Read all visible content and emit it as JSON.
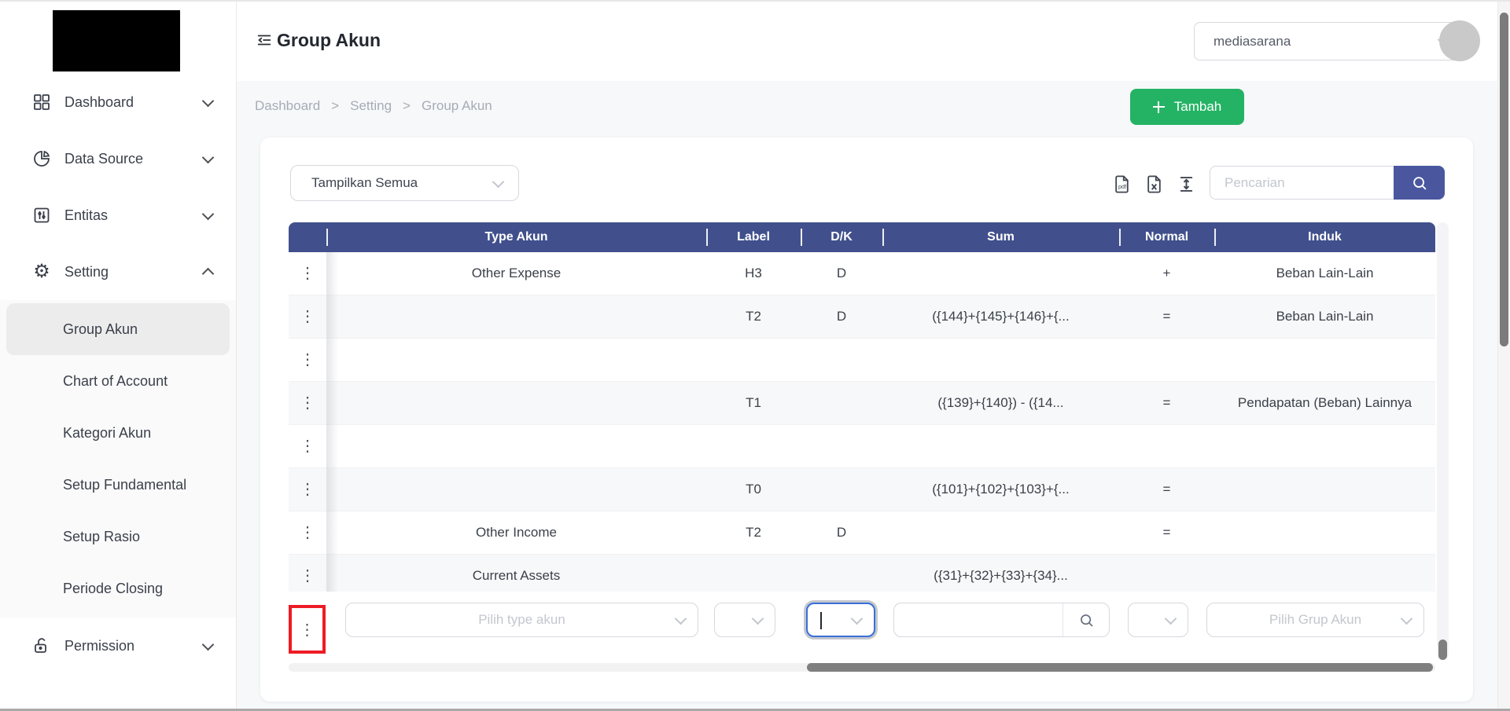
{
  "colors": {
    "indigo": "#41508c",
    "indigo-btn": "#4a579f",
    "green": "#24b364",
    "red": "#ed1c24"
  },
  "header": {
    "title": "Group Akun",
    "entity_selector_value": "mediasarana"
  },
  "breadcrumb": {
    "separator": ">",
    "items": {
      "0": "Dashboard",
      "1": "Setting",
      "2": "Group Akun"
    }
  },
  "actions": {
    "tambah_label": "Tambah"
  },
  "sidebar": {
    "items": {
      "0": {
        "label": "Dashboard"
      },
      "1": {
        "label": "Data Source"
      },
      "2": {
        "label": "Entitas"
      },
      "3": {
        "label": "Setting"
      },
      "4": {
        "label": "Permission"
      }
    },
    "submenu": [
      {
        "label": "Group Akun",
        "active": true
      },
      {
        "label": "Chart of Account"
      },
      {
        "label": "Kategori Akun"
      },
      {
        "label": "Setup Fundamental"
      },
      {
        "label": "Setup Rasio"
      },
      {
        "label": "Periode Closing"
      }
    ]
  },
  "toolbar": {
    "filter_value": "Tampilkan Semua",
    "search_placeholder": "Pencarian"
  },
  "table": {
    "columns": {
      "menu": "",
      "type": "Type Akun",
      "label": "Label",
      "dk": "D/K",
      "sum": "Sum",
      "normal": "Normal",
      "induk": "Induk"
    },
    "rows": [
      {
        "type": "Other Expense",
        "label": "H3",
        "dk": "D",
        "sum": "",
        "normal": "+",
        "induk": "Beban Lain-Lain"
      },
      {
        "type": "",
        "label": "T2",
        "dk": "D",
        "sum": "({144}+{145}+{146}+{...",
        "normal": "=",
        "induk": "Beban Lain-Lain"
      },
      {
        "type": "",
        "label": "",
        "dk": "",
        "sum": "",
        "normal": "",
        "induk": ""
      },
      {
        "type": "",
        "label": "T1",
        "dk": "",
        "sum": "({139}+{140}) - ({14...",
        "normal": "=",
        "induk": "Pendapatan (Beban) Lainnya"
      },
      {
        "type": "",
        "label": "",
        "dk": "",
        "sum": "",
        "normal": "",
        "induk": ""
      },
      {
        "type": "",
        "label": "T0",
        "dk": "",
        "sum": "({101}+{102}+{103}+{...",
        "normal": "=",
        "induk": ""
      },
      {
        "type": "Other Income",
        "label": "T2",
        "dk": "D",
        "sum": "",
        "normal": "=",
        "induk": ""
      },
      {
        "type": "Current Assets",
        "label": "",
        "dk": "",
        "sum": "({31}+{32}+{33}+{34}...",
        "normal": "",
        "induk": ""
      }
    ]
  },
  "form_row": {
    "type_placeholder": "Pilih type akun",
    "grup_placeholder": "Pilih Grup Akun"
  }
}
